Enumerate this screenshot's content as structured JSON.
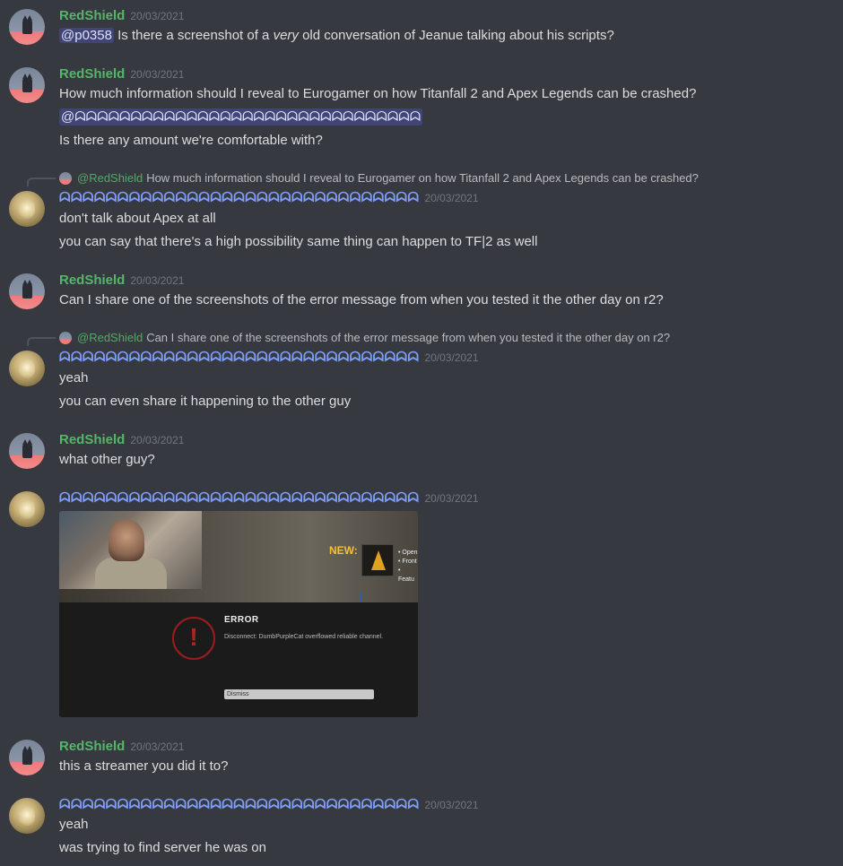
{
  "users": {
    "redshield": {
      "name": "RedShield",
      "avatar": "cat-avatar"
    },
    "other": {
      "name": "ᗣᗣᗣᗣᗣᗣᗣᗣᗣᗣᗣᗣᗣᗣᗣᗣᗣᗣᗣᗣᗣᗣᗣᗣᗣᗣᗣᗣᗣᗣᗣ",
      "avatar": "gold-avatar"
    }
  },
  "messages": [
    {
      "author": "RedShield",
      "timestamp": "20/03/2021",
      "mention": "@p0358",
      "text_before_italic": "Is there a screenshot of a",
      "italic": "very",
      "text_after_italic": "old conversation of Jeanue talking about his scripts?"
    },
    {
      "author": "RedShield",
      "timestamp": "20/03/2021",
      "lines": [
        "How much information should I reveal to Eurogamer on how Titanfall 2 and Apex Legends can be crashed?",
        "Is there any amount we're comfortable with?"
      ],
      "mention": "@ᗣᗣᗣᗣᗣᗣᗣᗣᗣᗣᗣᗣᗣᗣᗣᗣᗣᗣᗣᗣᗣᗣᗣᗣᗣᗣᗣᗣᗣᗣᗣ"
    },
    {
      "reply_to_user": "@RedShield",
      "reply_to_text": "How much information should I reveal to Eurogamer on how Titanfall 2 and Apex Legends can be crashed?",
      "author": "ᗣᗣᗣᗣᗣᗣᗣᗣᗣᗣᗣᗣᗣᗣᗣᗣᗣᗣᗣᗣᗣᗣᗣᗣᗣᗣᗣᗣᗣᗣᗣ",
      "timestamp": "20/03/2021",
      "lines": [
        "don't talk about Apex at all",
        "you can say that there's a high possibility same thing can happen to TF|2 as well"
      ]
    },
    {
      "author": "RedShield",
      "timestamp": "20/03/2021",
      "lines": [
        "Can I share one of the screenshots of the error message from when you tested it the other day on r2?"
      ]
    },
    {
      "reply_to_user": "@RedShield",
      "reply_to_text": "Can I share one of the screenshots of the error message from when you tested it the other day on r2?",
      "author": "ᗣᗣᗣᗣᗣᗣᗣᗣᗣᗣᗣᗣᗣᗣᗣᗣᗣᗣᗣᗣᗣᗣᗣᗣᗣᗣᗣᗣᗣᗣᗣ",
      "timestamp": "20/03/2021",
      "lines": [
        "yeah",
        "you can even share it happening to the other guy"
      ]
    },
    {
      "author": "RedShield",
      "timestamp": "20/03/2021",
      "lines": [
        "what other guy?"
      ]
    },
    {
      "author": "ᗣᗣᗣᗣᗣᗣᗣᗣᗣᗣᗣᗣᗣᗣᗣᗣᗣᗣᗣᗣᗣᗣᗣᗣᗣᗣᗣᗣᗣᗣᗣ",
      "timestamp": "20/03/2021",
      "attachment": {
        "new_label": "NEW:",
        "bullets": [
          "• Open",
          "• Front",
          "• Featu"
        ],
        "error_title": "ERROR",
        "error_icon": "!",
        "error_text": "Disconnect: DumbPurpleCat overflowed reliable channel.",
        "dismiss_label": "Dismiss"
      }
    },
    {
      "author": "RedShield",
      "timestamp": "20/03/2021",
      "lines": [
        "this a streamer you did it to?"
      ]
    },
    {
      "author": "ᗣᗣᗣᗣᗣᗣᗣᗣᗣᗣᗣᗣᗣᗣᗣᗣᗣᗣᗣᗣᗣᗣᗣᗣᗣᗣᗣᗣᗣᗣᗣ",
      "timestamp": "20/03/2021",
      "lines": [
        "yeah",
        "was trying to find server he was on"
      ]
    }
  ],
  "colors": {
    "background": "#36393f",
    "redshield_name": "#57b56a",
    "other_name": "#7e9ef8",
    "timestamp": "#72767d",
    "mention_bg": "#414675"
  }
}
